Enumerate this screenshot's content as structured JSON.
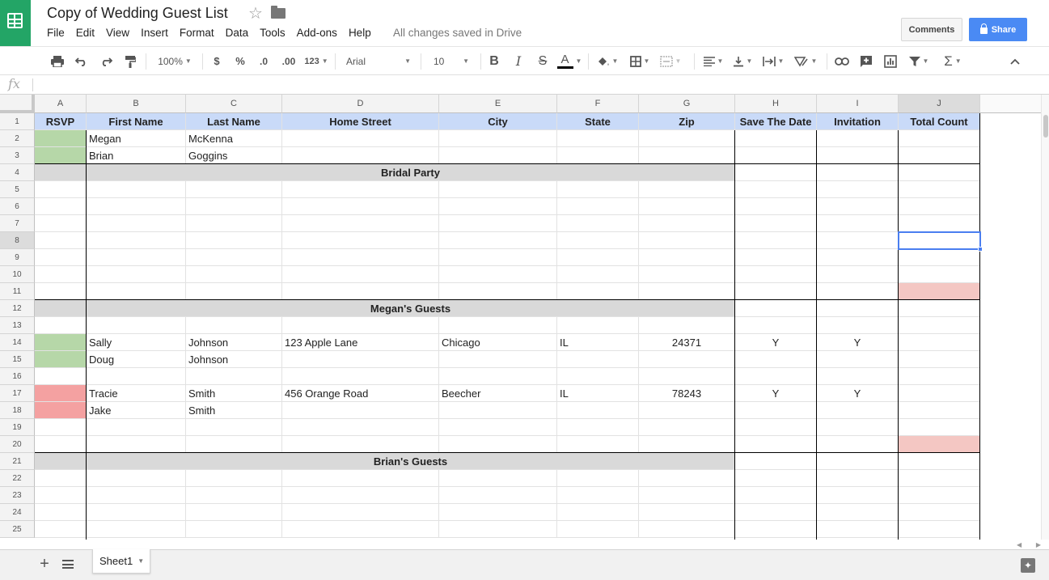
{
  "app": {
    "brand_color": "#23a566",
    "accent_color": "#4a8af4"
  },
  "document": {
    "title": "Copy of Wedding Guest List",
    "save_status": "All changes saved in Drive"
  },
  "menu": [
    "File",
    "Edit",
    "View",
    "Insert",
    "Format",
    "Data",
    "Tools",
    "Add-ons",
    "Help"
  ],
  "buttons": {
    "comments": "Comments",
    "share": "Share"
  },
  "toolbar": {
    "zoom": "100%",
    "currency": "$",
    "percent": "%",
    "decrease_decimal": ".0",
    "increase_decimal": ".00",
    "more_formats": "123",
    "font": "Arial",
    "font_size": "10",
    "bold": "B",
    "italic": "I",
    "strikethrough": "S",
    "text_color": "A"
  },
  "formula_bar": {
    "icon": "fx",
    "value": ""
  },
  "grid": {
    "columns": [
      "A",
      "B",
      "C",
      "D",
      "E",
      "F",
      "G",
      "H",
      "I",
      "J"
    ],
    "selected_column": "J",
    "selected_row": 8,
    "rows": [
      {
        "n": "1",
        "cells": [
          "RSVP",
          "First Name",
          "Last Name",
          "Home Street",
          "City",
          "State",
          "Zip",
          "Save The Date",
          "Invitation",
          "Total Count"
        ]
      },
      {
        "n": "2",
        "cells": [
          "",
          "Megan",
          "McKenna",
          "",
          "",
          "",
          "",
          "",
          "",
          ""
        ]
      },
      {
        "n": "3",
        "cells": [
          "",
          "Brian",
          "Goggins",
          "",
          "",
          "",
          "",
          "",
          "",
          ""
        ]
      },
      {
        "n": "4",
        "section": "Bridal Party"
      },
      {
        "n": "5"
      },
      {
        "n": "6"
      },
      {
        "n": "7"
      },
      {
        "n": "8"
      },
      {
        "n": "9"
      },
      {
        "n": "10"
      },
      {
        "n": "11"
      },
      {
        "n": "12",
        "section": "Megan's Guests"
      },
      {
        "n": "13"
      },
      {
        "n": "14",
        "cells": [
          "",
          "Sally",
          "Johnson",
          "123 Apple Lane",
          "Chicago",
          "IL",
          "24371",
          "Y",
          "Y",
          ""
        ]
      },
      {
        "n": "15",
        "cells": [
          "",
          "Doug",
          "Johnson",
          "",
          "",
          "",
          "",
          "",
          "",
          ""
        ]
      },
      {
        "n": "16"
      },
      {
        "n": "17",
        "cells": [
          "",
          "Tracie",
          "Smith",
          "456 Orange Road",
          "Beecher",
          "IL",
          "78243",
          "Y",
          "Y",
          ""
        ]
      },
      {
        "n": "18",
        "cells": [
          "",
          "Jake",
          "Smith",
          "",
          "",
          "",
          "",
          "",
          "",
          ""
        ]
      },
      {
        "n": "19"
      },
      {
        "n": "20"
      },
      {
        "n": "21",
        "section": "Brian's Guests"
      },
      {
        "n": "22"
      },
      {
        "n": "23"
      },
      {
        "n": "24"
      },
      {
        "n": "25"
      }
    ],
    "colors": {
      "header": "#c9daf8",
      "rsvp_yes": "#b6d7a8",
      "rsvp_no": "#f4a1a1",
      "total_highlight": "#f4c7c3",
      "section": "#d9d9d9"
    },
    "rsvp_status": {
      "2": "yes",
      "3": "yes",
      "14": "yes",
      "15": "yes",
      "17": "no",
      "18": "no"
    },
    "total_highlight_rows": [
      "11",
      "20"
    ]
  },
  "sheets": [
    {
      "name": "Sheet1",
      "active": true
    }
  ]
}
